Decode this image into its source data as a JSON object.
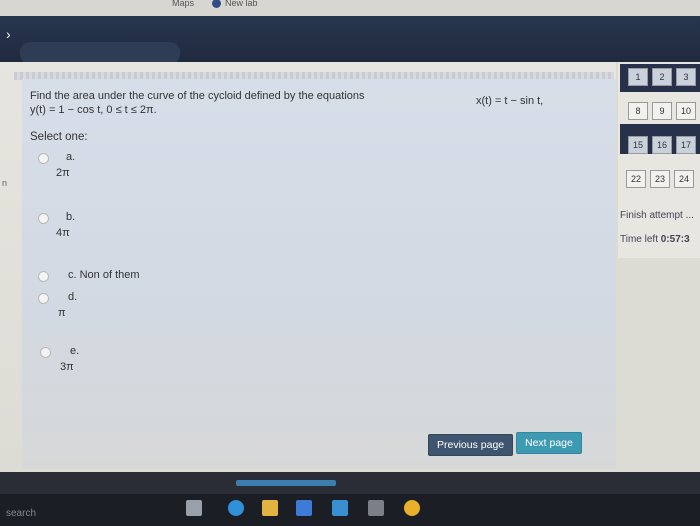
{
  "browser": {
    "bookmarks": [
      {
        "label": "Maps"
      },
      {
        "label": "New lab"
      }
    ]
  },
  "question": {
    "text_line1": "Find the area under the curve of the cycloid defined by the equations",
    "text_line2": "y(t) = 1 − cos t, 0 ≤ t ≤ 2π.",
    "equation_x": "x(t) = t − sin t,",
    "select_label": "Select one:",
    "options": [
      {
        "label": "a.",
        "value": "2π"
      },
      {
        "label": "b.",
        "value": "4π"
      },
      {
        "label": "c. Non of them",
        "value": ""
      },
      {
        "label": "d.",
        "value": "π"
      },
      {
        "label": "e.",
        "value": "3π"
      }
    ]
  },
  "buttons": {
    "previous": "Previous page",
    "next": "Next page"
  },
  "navigation": {
    "rows": [
      [
        "1",
        "2",
        "3"
      ],
      [
        "8",
        "9",
        "10"
      ],
      [
        "15",
        "16",
        "17"
      ],
      [
        "22",
        "23",
        "24"
      ]
    ],
    "finish_attempt": "Finish attempt ...",
    "time_left_label": "Time left",
    "time_left_value": "0:57:3"
  },
  "taskbar": {
    "search": "search"
  }
}
